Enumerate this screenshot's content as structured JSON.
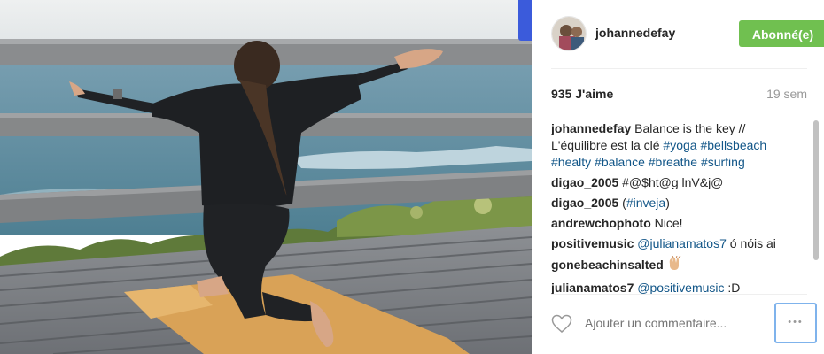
{
  "post": {
    "image_alt": "Woman in yoga pose on a wooden deck by the beach",
    "username": "johannedefay",
    "follow_label": "Abonné(e)",
    "likes": "935 J'aime",
    "age": "19 sem",
    "caption": {
      "author": "johannedefay",
      "text": "Balance is the key // L'équilibre est la clé",
      "tags": [
        "#yoga",
        "#bellsbeach",
        "#healty",
        "#balance",
        "#breathe",
        "#surfing"
      ]
    },
    "comments": [
      {
        "author": "digao_2005",
        "text": "#@$ht@g lnV&j@"
      },
      {
        "author": "digao_2005",
        "pre": "(",
        "tag": "#inveja",
        "post": ")"
      },
      {
        "author": "andrewchophoto",
        "text": "Nice!"
      },
      {
        "author": "positivemusic",
        "tag": "@julianamatos7",
        "post": " ó nóis ai"
      },
      {
        "author": "gonebeachinsalted",
        "icon": "clapping-hands-icon"
      },
      {
        "author": "julianamatos7",
        "tag": "@positivemusic",
        "post": " :D"
      }
    ],
    "add_comment_placeholder": "Ajouter un commentaire...",
    "more_label": "•••"
  },
  "colors": {
    "follow": "#70c050",
    "hashtag": "#125688",
    "focus_ring": "#7fb3ec"
  },
  "icons": {
    "like": "heart-outline-icon",
    "more": "ellipsis-icon"
  }
}
